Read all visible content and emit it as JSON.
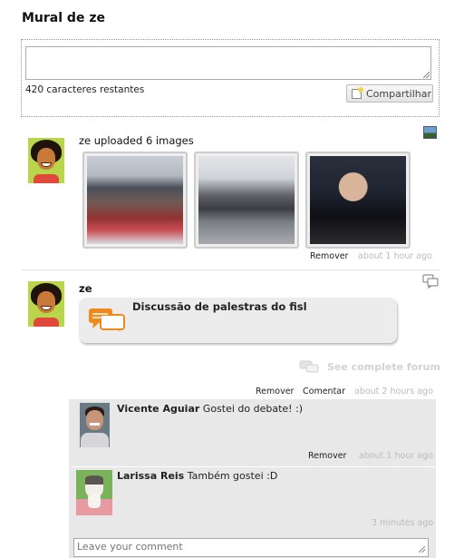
{
  "page": {
    "title": "Mural de ze"
  },
  "compose": {
    "value": "",
    "chars_left": "420 caracteres restantes",
    "share_label": "Compartilhar"
  },
  "posts": [
    {
      "author": "ze",
      "text": "ze uploaded 6 images",
      "photos": [
        "fisl-crowd-photo",
        "fisl-lecture-room-photo",
        "fisl-boy-tux-photo"
      ],
      "remove_label": "Remover",
      "time": "about 1 hour ago",
      "type_icon": "photo-icon"
    },
    {
      "author": "ze",
      "forum_title": "Discussão de palestras do fisl",
      "see_forum": "See complete forum",
      "remove_label": "Remover",
      "comment_label": "Comentar",
      "time": "about 2 hours ago",
      "type_icon": "forum-icon",
      "comments": [
        {
          "name": "Vicente Aguiar",
          "text": "Gostei do debate! :)",
          "remove_label": "Remover",
          "time": "about 1 hour ago"
        },
        {
          "name": "Larissa Reis",
          "text": "Também gostei :D",
          "time": "3 minutes ago"
        }
      ],
      "comment_placeholder": "Leave your comment"
    }
  ],
  "colors": {
    "forum_orange": "#f08a1c",
    "meta_gray": "#bbbbbb",
    "avatar_green": "#b9d64a"
  }
}
